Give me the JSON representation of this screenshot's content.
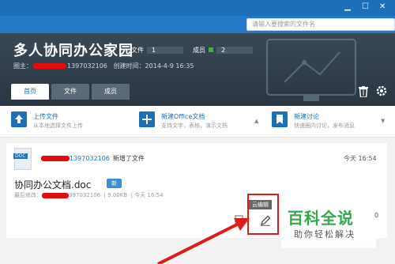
{
  "window": {
    "minimize_glyph": "▁",
    "maximize_glyph": "☐",
    "close_glyph": "✕"
  },
  "search": {
    "placeholder": "请输入要搜索的文件名"
  },
  "group": {
    "name": "多人协同办公家园",
    "files_label": "文件",
    "files_count": "1",
    "members_label": "成员",
    "members_count": "2",
    "owner_prefix": "圈主：",
    "owner_id": "1397032106",
    "created_prefix": "创建时间：",
    "created_time": "2014-4-9 16:35"
  },
  "tabs": [
    {
      "label": "首页",
      "active": true
    },
    {
      "label": "文件",
      "active": false
    },
    {
      "label": "成员",
      "active": false
    }
  ],
  "actions": {
    "upload": {
      "label": "上传文件",
      "sub": "从本地选择文件上传"
    },
    "new_doc": {
      "label": "新建Office文档",
      "sub": "支持文字，表格，演示文档"
    },
    "discuss": {
      "label": "新建讨论",
      "sub": "快速圈内讨论，发布消息"
    }
  },
  "feed": {
    "doc_badge": "DOC",
    "actor_id": "1397032106",
    "action_text": "新增了文件",
    "time": "今天 16:54",
    "file_name": "协同办公文档.doc",
    "new_badge": "新",
    "meta_prefix": "最后修改：",
    "meta_id": "397032106",
    "meta_size": "9.00KB",
    "meta_time": "今天 16:54",
    "cloud_edit_tip": "云编辑"
  },
  "watermark": {
    "title": "百科全说",
    "subtitle": "助你轻松解决"
  },
  "right_num": "0",
  "colors": {
    "primary": "#1d6fb8",
    "banner": "#2a3642",
    "highlight": "#e01919",
    "watermark": "#35a84b"
  }
}
